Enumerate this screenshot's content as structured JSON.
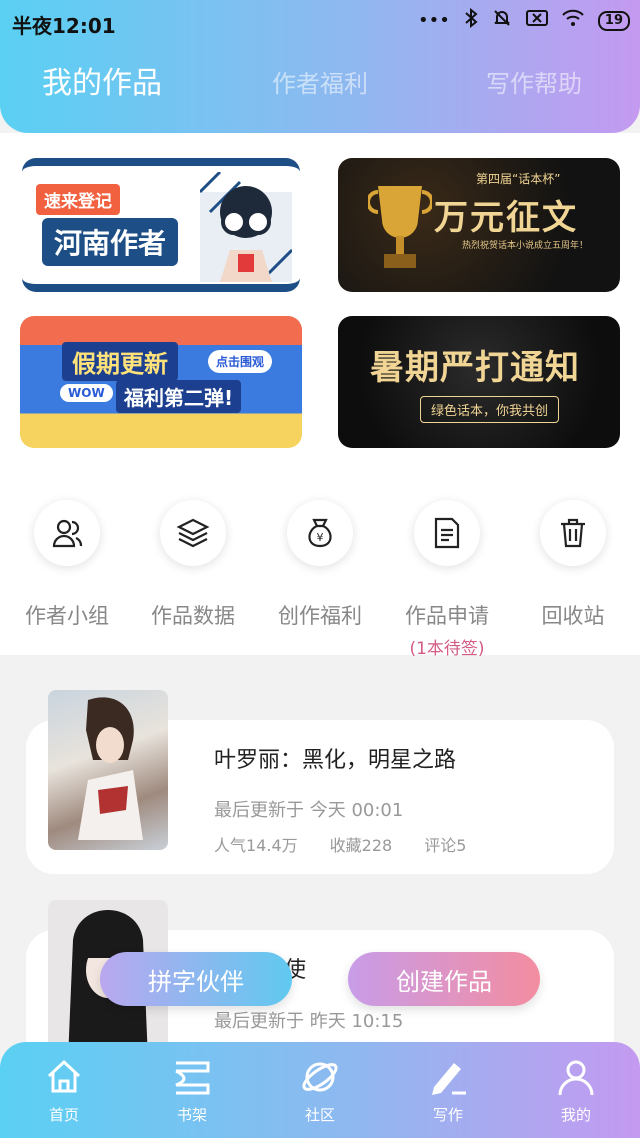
{
  "status_bar": {
    "time": "半夜12:01",
    "dots": "•••",
    "battery": "19"
  },
  "tabs": [
    {
      "label": "我的作品",
      "active": true
    },
    {
      "label": "作者福利",
      "active": false
    },
    {
      "label": "写作帮助",
      "active": false
    }
  ],
  "banners": {
    "b1": {
      "tag": "速来登记",
      "title": "河南作者"
    },
    "b2": {
      "small": "第四届“话本杯”",
      "title": "万元征文",
      "sub": "热烈祝贺话本小说成立五周年！"
    },
    "b3": {
      "title": "假期更新",
      "button": "点击围观",
      "wow": "WOW",
      "sub": "福利第二弹!"
    },
    "b4": {
      "title": "暑期严打通知",
      "sub": "绿色话本，你我共创"
    }
  },
  "quick_actions": [
    {
      "label": "作者小组",
      "icon": "group-icon"
    },
    {
      "label": "作品数据",
      "icon": "layers-icon"
    },
    {
      "label": "创作福利",
      "icon": "money-bag-icon"
    },
    {
      "label": "作品申请",
      "icon": "document-icon",
      "note": "(1本待签)"
    },
    {
      "label": "回收站",
      "icon": "trash-icon"
    }
  ],
  "works": [
    {
      "title": "叶罗丽：黑化，明星之路",
      "update": "最后更新于 今天 00:01",
      "popularity": "人气14.4万",
      "favorites": "收藏228",
      "comments": "评论5"
    },
    {
      "title": "使",
      "update": "最后更新于 昨天 10:15"
    }
  ],
  "float_buttons": {
    "partner": "拼字伙伴",
    "create": "创建作品"
  },
  "bottom_nav": [
    {
      "label": "首页",
      "icon": "home-icon"
    },
    {
      "label": "书架",
      "icon": "bookshelf-icon"
    },
    {
      "label": "社区",
      "icon": "planet-icon"
    },
    {
      "label": "写作",
      "icon": "pen-icon",
      "active": true
    },
    {
      "label": "我的",
      "icon": "user-icon"
    }
  ],
  "colors": {
    "accent_start": "#5ad0f2",
    "accent_end": "#c49af0",
    "note_pink": "#d35c84"
  }
}
